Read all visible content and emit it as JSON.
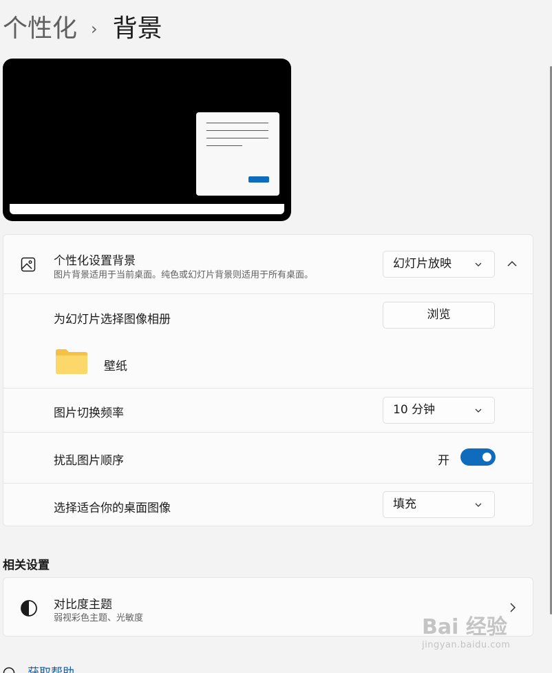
{
  "breadcrumb": {
    "parent": "个性化",
    "separator": "›",
    "current": "背景"
  },
  "personalize": {
    "title": "个性化设置背景",
    "description": "图片背景适用于当前桌面。纯色或幻灯片背景则适用于所有桌面。",
    "selected": "幻灯片放映",
    "icon": "image-icon"
  },
  "album": {
    "label": "为幻灯片选择图像相册",
    "button": "浏览",
    "folder_name": "壁纸"
  },
  "interval": {
    "label": "图片切换频率",
    "selected": "10 分钟"
  },
  "shuffle": {
    "label": "扰乱图片顺序",
    "state": "开",
    "on": true
  },
  "fit": {
    "label": "选择适合你的桌面图像",
    "selected": "填充"
  },
  "related": {
    "heading": "相关设置",
    "contrast_title": "对比度主题",
    "contrast_sub": "弱视彩色主题、光敏度"
  },
  "help": {
    "label": "获取帮助"
  },
  "watermark": {
    "main": "Bai 经验",
    "sub": "jingyan.baidu.com"
  },
  "colors": {
    "accent": "#0f6cbd",
    "background": "#f3f3f3",
    "card": "#fbfbfb"
  }
}
